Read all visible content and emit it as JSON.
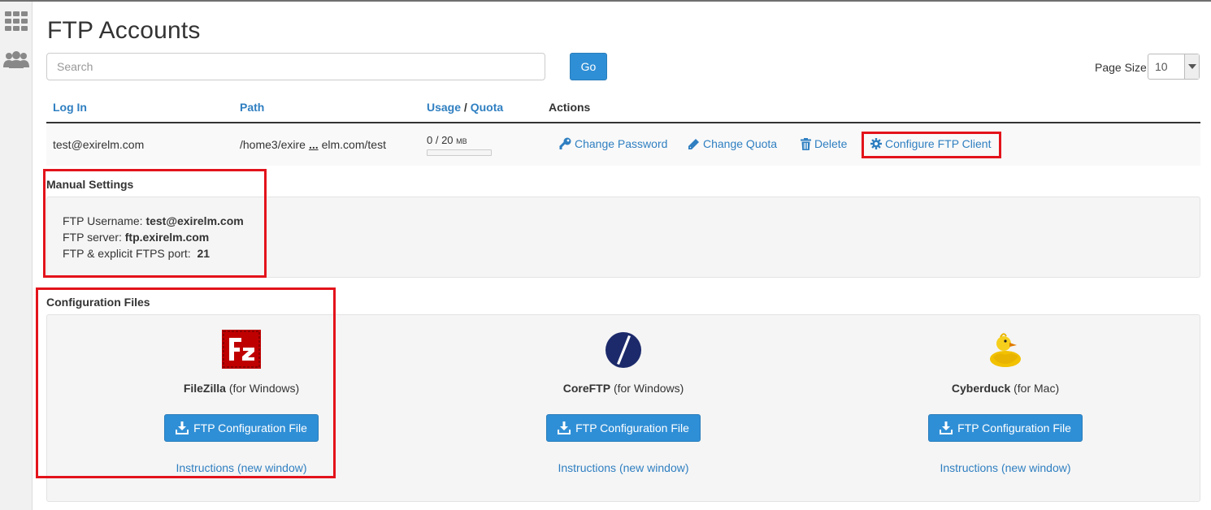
{
  "sidebar": {
    "icons": [
      "apps-grid-icon",
      "users-icon"
    ]
  },
  "page": {
    "title": "FTP Accounts"
  },
  "search": {
    "placeholder": "Search",
    "go_label": "Go"
  },
  "page_size": {
    "label": "Page Size",
    "value": "10"
  },
  "table": {
    "headers": {
      "login": "Log In",
      "path": "Path",
      "usage": "Usage",
      "slash": "/",
      "quota": "Quota",
      "actions": "Actions"
    },
    "rows": [
      {
        "login": "test@exirelm.com",
        "path_start": "/home3/exire",
        "path_ellipsis": "...",
        "path_end": "elm.com/test",
        "usage_value": "0 / 20",
        "usage_unit": "MB",
        "usage_fraction": 0
      }
    ],
    "actions": {
      "change_password": "Change Password",
      "change_quota": "Change Quota",
      "delete": "Delete",
      "configure_ftp_client": "Configure FTP Client"
    }
  },
  "manual_settings": {
    "title": "Manual Settings",
    "username_label": "FTP Username:",
    "username_value": "test@exirelm.com",
    "server_label": "FTP server:",
    "server_value": "ftp.exirelm.com",
    "port_label": "FTP & explicit FTPS port:",
    "port_value": "21"
  },
  "config_files": {
    "title": "Configuration Files",
    "clients": [
      {
        "name": "FileZilla",
        "platform": "(for Windows)",
        "button": "FTP Configuration File",
        "instructions": "Instructions (new window)",
        "icon": "filezilla-logo-icon"
      },
      {
        "name": "CoreFTP",
        "platform": "(for Windows)",
        "button": "FTP Configuration File",
        "instructions": "Instructions (new window)",
        "icon": "coreftp-logo-icon"
      },
      {
        "name": "Cyberduck",
        "platform": "(for Mac)",
        "button": "FTP Configuration File",
        "instructions": "Instructions (new window)",
        "icon": "cyberduck-logo-icon"
      }
    ]
  },
  "colors": {
    "accent": "#2f8fd6",
    "link": "#2f7fc1",
    "highlight_box": "#e3131b"
  }
}
